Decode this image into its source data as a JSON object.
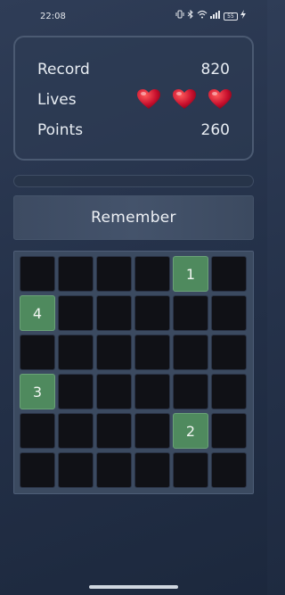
{
  "status_bar": {
    "time": "22:08",
    "battery": "55",
    "icons": [
      "vibrate-icon",
      "bluetooth-icon",
      "wifi-icon",
      "signal-icon",
      "battery-icon",
      "charging-icon"
    ]
  },
  "stats": {
    "record_label": "Record",
    "record_value": "820",
    "lives_label": "Lives",
    "lives_count": 3,
    "points_label": "Points",
    "points_value": "260"
  },
  "progress": {
    "fraction": 0
  },
  "banner": {
    "text": "Remember"
  },
  "board": {
    "rows": 6,
    "cols": 6,
    "cells": [
      [
        "",
        "",
        "",
        "",
        "1",
        ""
      ],
      [
        "4",
        "",
        "",
        "",
        "",
        ""
      ],
      [
        "",
        "",
        "",
        "",
        "",
        ""
      ],
      [
        "3",
        "",
        "",
        "",
        "",
        ""
      ],
      [
        "",
        "",
        "",
        "",
        "2",
        ""
      ],
      [
        "",
        "",
        "",
        "",
        "",
        ""
      ]
    ]
  },
  "colors": {
    "tile_dark": "#101116",
    "tile_lit": "#4f8a5e",
    "heart": "#c8102e"
  }
}
